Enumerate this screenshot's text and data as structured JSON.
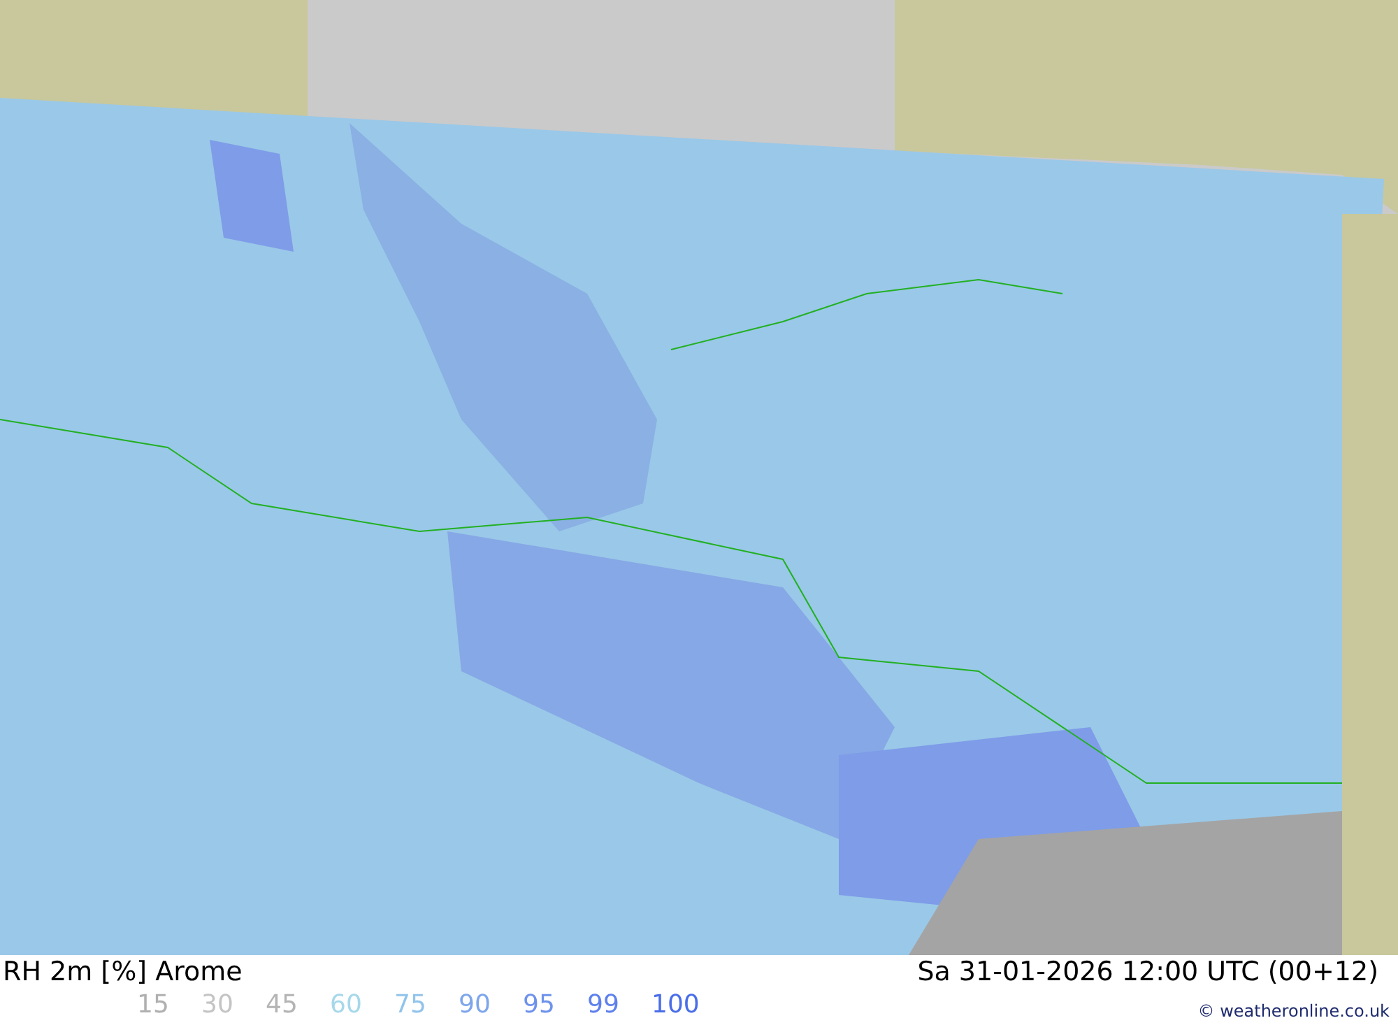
{
  "map": {
    "title": "RH 2m [%] Arome",
    "valid_time": "Sa 31-01-2026 12:00 UTC (00+12)"
  },
  "legend": [
    {
      "label": "15",
      "color": "#b0b0b0"
    },
    {
      "label": "30",
      "color": "#c4c4c4"
    },
    {
      "label": "45",
      "color": "#b4b4b4"
    },
    {
      "label": "60",
      "color": "#a6d8ea"
    },
    {
      "label": "75",
      "color": "#92c4ea"
    },
    {
      "label": "90",
      "color": "#7ea6ec"
    },
    {
      "label": "95",
      "color": "#6e92ec"
    },
    {
      "label": "99",
      "color": "#5e80ec"
    },
    {
      "label": "100",
      "color": "#4a6ee8"
    }
  ],
  "credit": "© weatheronline.co.uk"
}
